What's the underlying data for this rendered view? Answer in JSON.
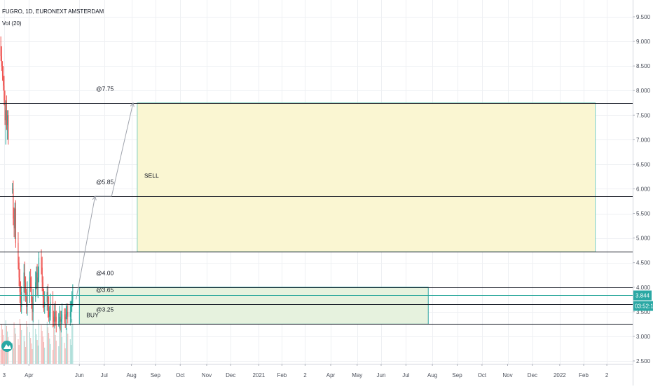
{
  "legend": {
    "title": "FUGRO, 1D, EURONEXT AMSTERDAM",
    "volume": "Vol (20)"
  },
  "chart_data": {
    "type": "candlestick",
    "title": "FUGRO, 1D, EURONEXT AMSTERDAM",
    "y_axis": {
      "ticks": [
        "9.500",
        "9.000",
        "8.500",
        "8.000",
        "7.500",
        "7.000",
        "6.500",
        "6.000",
        "5.500",
        "5.000",
        "4.500",
        "4.000",
        "3.500",
        "3.000",
        "2.500"
      ],
      "range": [
        2.4,
        9.75
      ]
    },
    "x_axis": {
      "ticks": [
        "3",
        "Apr",
        "Jun",
        "Jul",
        "Aug",
        "Sep",
        "Oct",
        "Nov",
        "Dec",
        "2021",
        "Feb",
        "2",
        "Apr",
        "May",
        "Jun",
        "Jul",
        "Aug",
        "Sep",
        "Oct",
        "Nov",
        "Dec",
        "2022",
        "Feb",
        "2"
      ],
      "range": [
        "2020-02-26",
        "2022-03-10"
      ]
    },
    "price_levels": [
      {
        "label": "@7.75",
        "value": 7.75
      },
      {
        "label": "@5.85",
        "value": 5.85
      },
      {
        "label": "",
        "value": 4.72
      },
      {
        "label": "@4.00",
        "value": 4.0
      },
      {
        "label": "@3.65",
        "value": 3.65
      },
      {
        "label": "@3.25",
        "value": 3.25
      }
    ],
    "zones": [
      {
        "label": "SELL",
        "from": "2020-08-10",
        "to": "2022-02-15",
        "low": 4.72,
        "high": 7.75,
        "fill": "#faf6d2",
        "border": "#7ccfbd"
      },
      {
        "label": "BUY",
        "from": "2020-06-01",
        "to": "2021-07-28",
        "low": 3.25,
        "high": 4.0,
        "fill": "#e6f2de",
        "border": "#2fa5a0"
      }
    ],
    "arrow_path": [
      {
        "date": "2020-05-28",
        "price": 3.75
      },
      {
        "date": "2020-06-20",
        "price": 5.85
      },
      {
        "date": "2020-07-10",
        "price": 5.85
      },
      {
        "date": "2020-08-05",
        "price": 7.75
      }
    ],
    "current_price": {
      "value": 3.844,
      "label": "3.844",
      "countdown": "03:52:10",
      "color": "#26a69a"
    },
    "colors": {
      "up": "#26a69a",
      "down": "#ef5350",
      "grid": "#eef0f3",
      "level_line": "#131722",
      "arrow": "#a0a4ad",
      "badge": "#2aa8a4"
    }
  }
}
